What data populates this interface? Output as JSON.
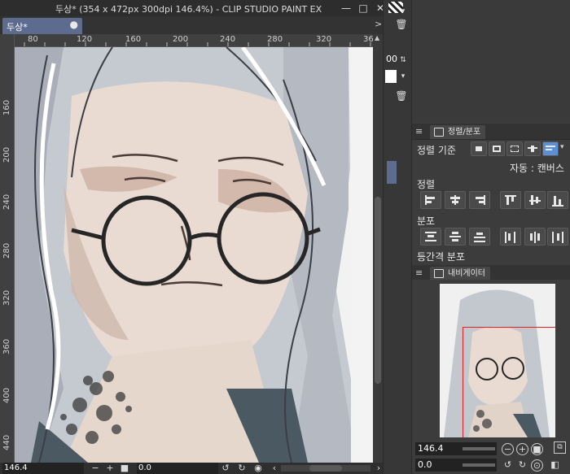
{
  "window": {
    "title": "두상* (354 x 472px 300dpi 146.4%)  - CLIP STUDIO PAINT EX"
  },
  "document_tab": {
    "label": "두상*",
    "modified_dot": "●"
  },
  "ruler": {
    "top_labels": [
      "80",
      "120",
      "160",
      "200",
      "240",
      "280",
      "320",
      "36"
    ],
    "left_labels": [
      "160",
      "200",
      "240",
      "280",
      "320",
      "360",
      "400",
      "440"
    ]
  },
  "status": {
    "zoom": "146.4",
    "angle": "0.0"
  },
  "side_strip": {
    "value_fragment": "00"
  },
  "align_panel": {
    "tab_label": "정렬/분포",
    "align_basis_label": "정렬 기준",
    "auto_label": "자동 : 캔버스",
    "align_label": "정렬",
    "distribute_label": "분포",
    "equal_spacing_label": "등간격 분포"
  },
  "navigator": {
    "tab_label": "내비게이터",
    "zoom": "146.4",
    "angle": "0.0"
  },
  "colors": {
    "accent_tab": "#5d6b8f",
    "selected_button": "#5b8fd6",
    "nav_frame": "#e02020"
  }
}
